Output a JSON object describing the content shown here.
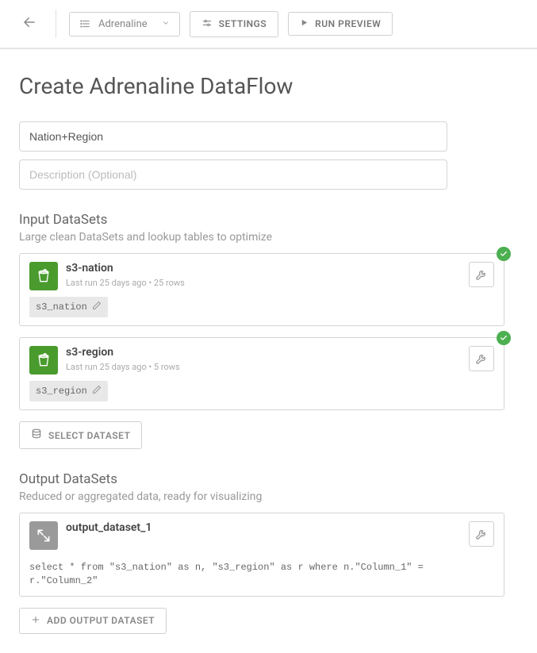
{
  "topbar": {
    "engine_label": "Adrenaline",
    "settings_label": "SETTINGS",
    "run_preview_label": "RUN PREVIEW"
  },
  "page": {
    "title": "Create Adrenaline DataFlow",
    "name_value": "Nation+Region",
    "description_placeholder": "Description (Optional)"
  },
  "input_section": {
    "title": "Input DataSets",
    "subtitle": "Large clean DataSets and lookup tables to optimize",
    "datasets": [
      {
        "name": "s3-nation",
        "meta": "Last run 25 days ago • 25 rows",
        "alias": "s3_nation"
      },
      {
        "name": "s3-region",
        "meta": "Last run 25 days ago • 5 rows",
        "alias": "s3_region"
      }
    ],
    "select_button": "SELECT DATASET"
  },
  "output_section": {
    "title": "Output DataSets",
    "subtitle": "Reduced or aggregated data, ready for visualizing",
    "dataset": {
      "name": "output_dataset_1",
      "query": "select * from \"s3_nation\" as n, \"s3_region\" as r where n.\"Column_1\" = r.\"Column_2\""
    },
    "add_button": "ADD OUTPUT DATASET"
  }
}
